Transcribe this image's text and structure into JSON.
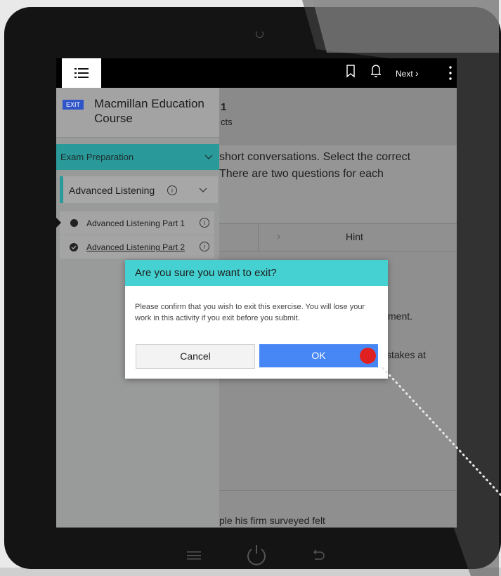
{
  "topbar": {
    "menu_icon": "list-menu-icon",
    "bookmark_icon": "bookmark-icon",
    "bell_icon": "bell-icon",
    "next_label": "Next",
    "more_icon": "more-vertical-icon"
  },
  "sidebar": {
    "exit_badge": "EXIT",
    "course_title": "Macmillan Education Course",
    "section_label": "Exam Preparation",
    "subsection_label": "Advanced Listening",
    "parts": [
      {
        "label": "Advanced Listening Part 1"
      },
      {
        "label": "Advanced Listening Part 2"
      }
    ]
  },
  "main": {
    "heading_number": "1",
    "heading_sub": "cts",
    "instruction_line1": "short conversations. Select the correct",
    "instruction_line2": "There are two questions for each",
    "hint_label": "Hint",
    "text_fragment_1": "ment.",
    "text_fragment_2": "stakes at",
    "bottom_fragment": "ple his firm surveyed felt"
  },
  "dialog": {
    "title": "Are you sure you want to exit?",
    "message": "Please confirm that you wish to exit this exercise. You will lose your work in this activity if you exit before you submit.",
    "cancel_label": "Cancel",
    "ok_label": "OK"
  },
  "colors": {
    "accent_teal": "#2a9999",
    "dialog_header": "#45d1d1",
    "ok_button": "#4787f5",
    "exit_badge": "#2f55c9",
    "click_marker": "#e02121"
  }
}
